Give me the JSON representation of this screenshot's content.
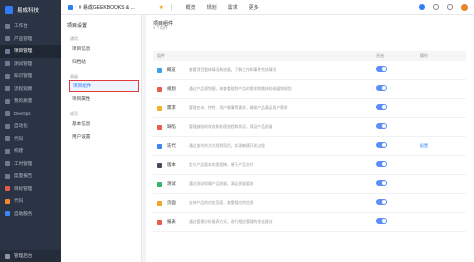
{
  "app": {
    "name": "易成科技"
  },
  "sidebar": {
    "items": [
      {
        "label": "工作台",
        "icon": "dashboard-icon",
        "color": "gray"
      },
      {
        "label": "产品管理",
        "icon": "product-icon",
        "color": "gray"
      },
      {
        "label": "项目管理",
        "icon": "project-icon",
        "color": "gray",
        "active": true
      },
      {
        "label": "测试管理",
        "icon": "test-icon",
        "color": "gray"
      },
      {
        "label": "知识管理",
        "icon": "wiki-icon",
        "color": "gray"
      },
      {
        "label": "流程观察",
        "icon": "flow-icon",
        "color": "gray"
      },
      {
        "label": "我的质量",
        "icon": "quality-icon",
        "color": "gray"
      },
      {
        "label": "DevOps",
        "icon": "devops-icon",
        "color": "gray"
      },
      {
        "label": "自动化",
        "icon": "automation-icon",
        "color": "gray"
      },
      {
        "label": "代码",
        "icon": "code-icon",
        "color": "gray"
      },
      {
        "label": "构建",
        "icon": "build-icon",
        "color": "gray"
      },
      {
        "label": "工时管理",
        "icon": "timesheet-icon",
        "color": "gray"
      },
      {
        "label": "度量报告",
        "icon": "report-icon",
        "color": "gray"
      },
      {
        "label": "目标管理",
        "icon": "goal-icon",
        "color": "red"
      },
      {
        "label": "代码",
        "icon": "code2-icon",
        "color": "orange"
      },
      {
        "label": "自助服务",
        "icon": "service-icon",
        "color": "blue"
      }
    ],
    "footer_label": "管理后台"
  },
  "topbar": {
    "project": "# 易成GEEKBOOKS & ...",
    "tabs": [
      "概览",
      "规划",
      "需求",
      "更多"
    ]
  },
  "settings": {
    "title": "项目设置",
    "groups": [
      {
        "label": "通用",
        "items": [
          {
            "label": "项目信息"
          },
          {
            "label": "归档站"
          }
        ]
      },
      {
        "label": "高级",
        "items": [
          {
            "label": "项目组件",
            "selected": true
          },
          {
            "label": "项目属性"
          }
        ]
      },
      {
        "label": "成员",
        "items": [
          {
            "label": "基本信息"
          },
          {
            "label": "用户设置"
          }
        ]
      }
    ]
  },
  "main": {
    "title": "项目组件",
    "subtitle": "9 个组件",
    "headers": {
      "name": "组件",
      "enabled": "开启",
      "op": "操作"
    },
    "rows": [
      {
        "name": "概览",
        "icon": "overview-icon",
        "color": "#3aa3e8",
        "desc": "查看项目整体情况和进展，了解工作和事件完成情况",
        "on": true,
        "op": ""
      },
      {
        "name": "规划",
        "icon": "plan-icon",
        "color": "#e85b4b",
        "desc": "通过产品规划图，来查看规划产品的需求和路线的进展和规划",
        "on": true,
        "op": ""
      },
      {
        "name": "需求",
        "icon": "requirement-icon",
        "color": "#f3b12a",
        "desc": "管理史诗、特性、用户故事等需求，确保产品满足用户需求",
        "on": true,
        "op": ""
      },
      {
        "name": "缺陷",
        "icon": "bug-icon",
        "color": "#e85b4b",
        "desc": "管理缺陷的状态和处理流程和状况，保证产品质量",
        "on": true,
        "op": ""
      },
      {
        "name": "迭代",
        "icon": "iteration-icon",
        "color": "#3e84f2",
        "desc": "通过迭代的方式规划项目，实现敏捷开发过程",
        "on": true,
        "op": "配置"
      },
      {
        "name": "版本",
        "icon": "version-icon",
        "color": "#444c5a",
        "desc": "定义产品版本的里程碑，便于产品交付",
        "on": true,
        "op": ""
      },
      {
        "name": "测试",
        "icon": "test-case-icon",
        "color": "#39b36a",
        "desc": "通过测试保障产品质量，满足质量要求",
        "on": true,
        "op": ""
      },
      {
        "name": "页面",
        "icon": "page-icon",
        "color": "#f3a42b",
        "desc": "支持产品的对应页面，查看相应的信息",
        "on": true,
        "op": ""
      },
      {
        "name": "报表",
        "icon": "report-chart-icon",
        "color": "#e85b4b",
        "desc": "通过管理分析报表方式，进行相应管理的优化建议",
        "on": true,
        "op": ""
      }
    ]
  }
}
